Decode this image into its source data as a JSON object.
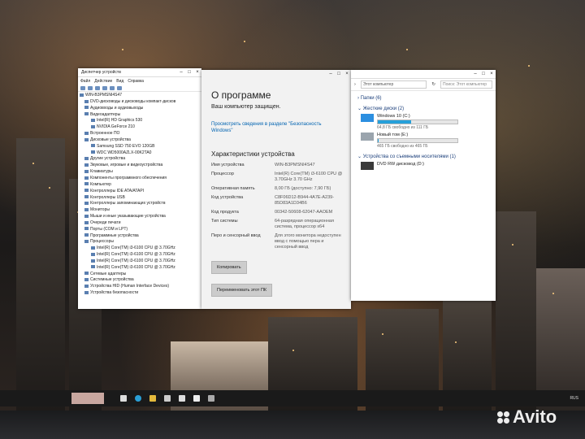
{
  "device_manager": {
    "title": "Диспетчер устройств",
    "menu": [
      "Файл",
      "Действие",
      "Вид",
      "Справка"
    ],
    "root": "WIN-B3PMSNI4S47",
    "nodes": [
      "DVD-дисководы и дисководы компакт-дисков",
      "Аудиовходы и аудиовыходы",
      "Видеоадаптеры",
      "Intel(R) HD Graphics 530",
      "NVIDIA GeForce 210",
      "Встроенное ПО",
      "Дисковые устройства",
      "Samsung SSD 750 EVO 120GB",
      "WDC WD5000AZLX-00K2TA0",
      "Другие устройства",
      "Звуковые, игровые и видеоустройства",
      "Клавиатуры",
      "Компоненты программного обеспечения",
      "Компьютер",
      "Контроллеры IDE ATA/ATAPI",
      "Контроллеры USB",
      "Контроллеры запоминающих устройств",
      "Мониторы",
      "Мыши и иные указывающие устройства",
      "Очереди печати",
      "Порты (COM и LPT)",
      "Программные устройства",
      "Процессоры",
      "Intel(R) Core(TM) i3-6100 CPU @ 3.70GHz",
      "Intel(R) Core(TM) i3-6100 CPU @ 3.70GHz",
      "Intel(R) Core(TM) i3-6100 CPU @ 3.70GHz",
      "Intel(R) Core(TM) i3-6100 CPU @ 3.70GHz",
      "Сетевые адаптеры",
      "Системные устройства",
      "Устройства HID (Human Interface Devices)",
      "Устройства безопасности"
    ]
  },
  "about": {
    "heading": "О программе",
    "protected": "Ваш компьютер защищен.",
    "link": "Просмотреть сведения в разделе \"Безопасность Windows\"",
    "specs_title": "Характеристики устройства",
    "specs": [
      {
        "k": "Имя устройства",
        "v": "WIN-B3PMSNI4S47"
      },
      {
        "k": "Процессор",
        "v": "Intel(R) Core(TM) i3-6100 CPU @ 3.70GHz 3.70 GHz"
      },
      {
        "k": "Оперативная память",
        "v": "8,00 ГБ (доступно: 7,90 ГБ)"
      },
      {
        "k": "Код устройства",
        "v": "C8F06D12-B944-4A7E-A239-85D83A1D34B6"
      },
      {
        "k": "Код продукта",
        "v": "00342-50608-62047-AAOEM"
      },
      {
        "k": "Тип системы",
        "v": "64-разрядная операционная система, процессор x64"
      },
      {
        "k": "Перо и сенсорный ввод",
        "v": "Для этого монитора недоступен ввод с помощью пера и сенсорный ввод"
      }
    ],
    "copy_btn": "Копировать",
    "rename_btn": "Переименовать этот ПК"
  },
  "explorer": {
    "address": "Этот компьютер",
    "search_placeholder": "Поиск: Этот компьютер",
    "folders": "Папки (6)",
    "disks_title": "Жесткие диски (2)",
    "drives": [
      {
        "name": "Windows 10 (C:)",
        "free": "64,8 ГБ свободно из 111 ГБ",
        "used_frac": 0.42
      },
      {
        "name": "Новый том (E:)",
        "free": "465 ГБ свободно из 465 ГБ",
        "used_frac": 0.01
      }
    ],
    "removable_title": "Устройства со съемными носителями (1)",
    "dvd": "DVD RW дисковод (D:)"
  },
  "taskbar": {
    "tray": [
      "RUS"
    ]
  },
  "watermark": "Avito"
}
